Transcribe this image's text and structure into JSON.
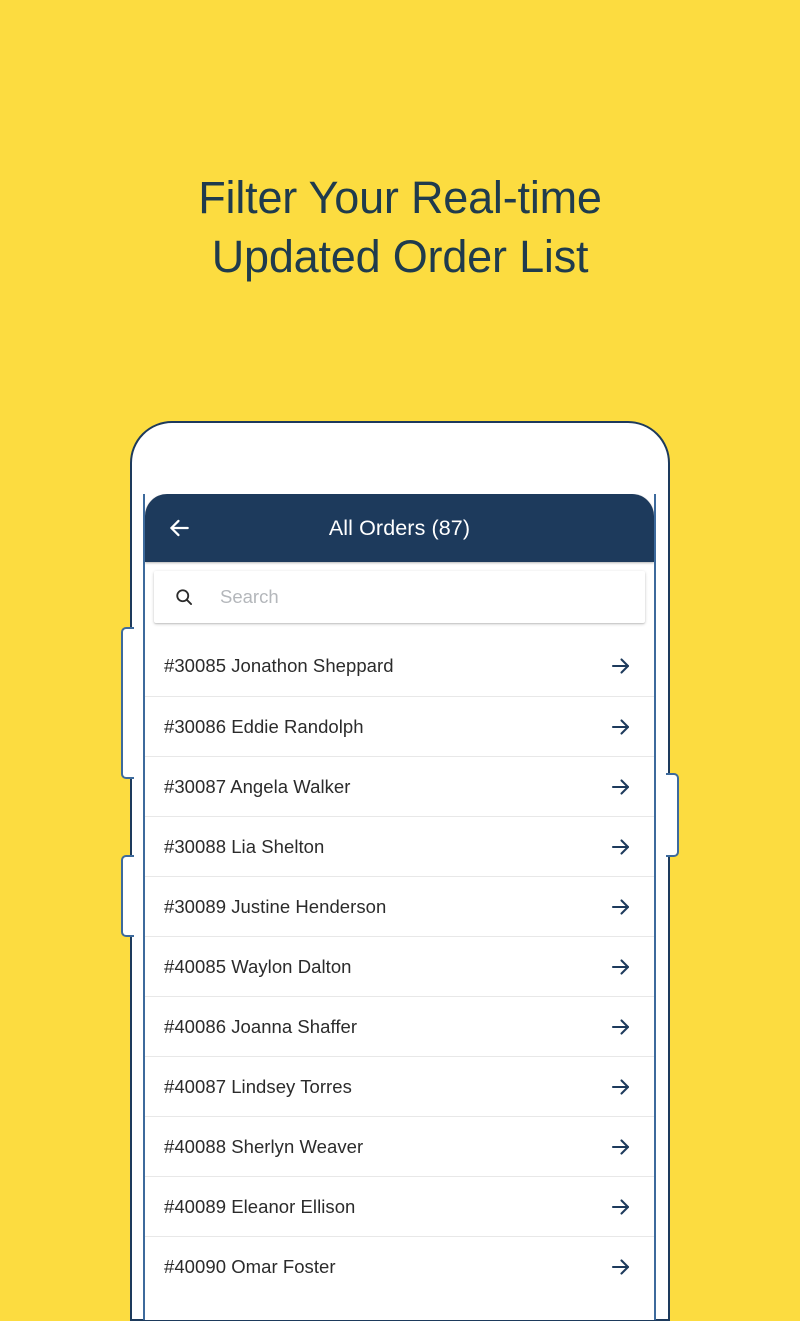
{
  "background_color": "#fcdc40",
  "accent_color": "#1d3a5c",
  "promo": {
    "headline": "Filter Your Real-time\nUpdated Order List"
  },
  "phone": {
    "buttons": {
      "volume_up": "volume-up-button",
      "volume_down": "volume-down-button",
      "power": "power-button"
    }
  },
  "app": {
    "appbar": {
      "back_icon": "arrow-left-icon",
      "title": "All Orders (87)"
    },
    "search": {
      "icon": "search-icon",
      "placeholder": "Search",
      "value": ""
    },
    "orders": [
      {
        "id": "#30085",
        "name": "Jonathon Sheppard",
        "label": "#30085 Jonathon Sheppard"
      },
      {
        "id": "#30086",
        "name": "Eddie Randolph",
        "label": "#30086 Eddie Randolph"
      },
      {
        "id": "#30087",
        "name": "Angela Walker",
        "label": "#30087 Angela Walker"
      },
      {
        "id": "#30088",
        "name": "Lia Shelton",
        "label": "#30088 Lia Shelton"
      },
      {
        "id": "#30089",
        "name": "Justine Henderson",
        "label": "#30089 Justine Henderson"
      },
      {
        "id": "#40085",
        "name": "Waylon Dalton",
        "label": "#40085 Waylon Dalton"
      },
      {
        "id": "#40086",
        "name": "Joanna Shaffer",
        "label": "#40086 Joanna Shaffer"
      },
      {
        "id": "#40087",
        "name": "Lindsey Torres",
        "label": "#40087 Lindsey Torres"
      },
      {
        "id": "#40088",
        "name": "Sherlyn Weaver",
        "label": "#40088 Sherlyn Weaver"
      },
      {
        "id": "#40089",
        "name": "Eleanor Ellison",
        "label": "#40089 Eleanor Ellison"
      },
      {
        "id": "#40090",
        "name": "Omar Foster",
        "label": "#40090 Omar Foster"
      }
    ],
    "row_arrow_icon": "arrow-right-icon"
  }
}
